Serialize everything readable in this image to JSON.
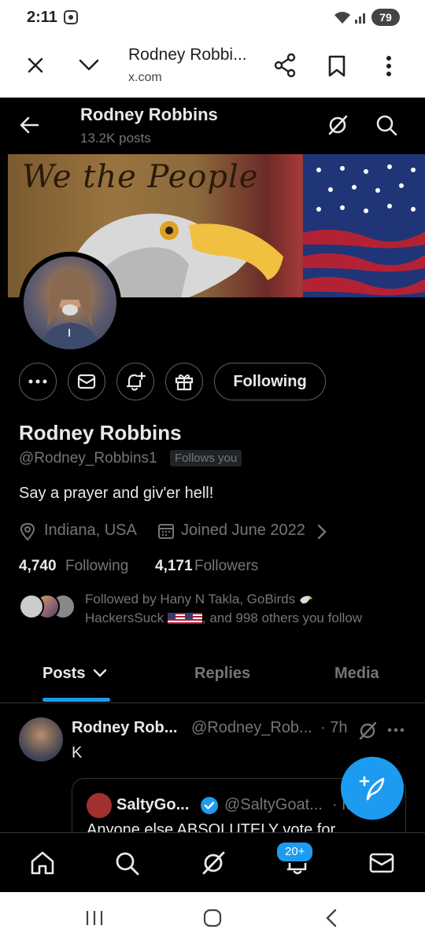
{
  "status_bar": {
    "time": "2:11",
    "battery": "79"
  },
  "browser": {
    "title": "Rodney Robbi...",
    "url": "x.com"
  },
  "profile_header": {
    "name": "Rodney Robbins",
    "posts": "13.2K posts"
  },
  "banner": {
    "text": "We the People"
  },
  "actions": {
    "following_label": "Following"
  },
  "profile": {
    "name": "Rodney Robbins",
    "handle": "@Rodney_Robbins1",
    "follows_you": "Follows you",
    "bio": "Say a prayer and giv'er hell!",
    "location": "Indiana, USA",
    "joined": "Joined June 2022",
    "following_count": "4,740",
    "following_label": "Following",
    "followers_count": "4,171",
    "followers_label": "Followers",
    "followed_by_line1": "Followed by Hany N Takla, GoBirds",
    "followed_by_line2_pre": "HackersSuck",
    "followed_by_line2_post": ", and 998 others you follow"
  },
  "tabs": {
    "posts": "Posts",
    "replies": "Replies",
    "media": "Media"
  },
  "post": {
    "name": "Rodney Rob...",
    "handle": "@Rodney_Rob...",
    "time": "· 7h",
    "text": "K",
    "quote": {
      "name": "SaltyGo...",
      "handle": "@SaltyGoat...",
      "time": "· Mar 4",
      "text": "Anyone else ABSOLUTELY vote for"
    }
  },
  "bottom_nav": {
    "notifications_badge": "20+"
  },
  "colors": {
    "accent": "#1d9bf0",
    "background": "#000000",
    "muted": "#71767b"
  },
  "icons": [
    "close-icon",
    "chevron-down-icon",
    "share-icon",
    "bookmark-icon",
    "kebab-icon",
    "back-arrow-icon",
    "grok-icon",
    "search-icon",
    "more-icon",
    "mail-icon",
    "bell-plus-icon",
    "gift-icon",
    "location-icon",
    "calendar-icon",
    "home-icon",
    "bell-icon",
    "compose-icon"
  ]
}
